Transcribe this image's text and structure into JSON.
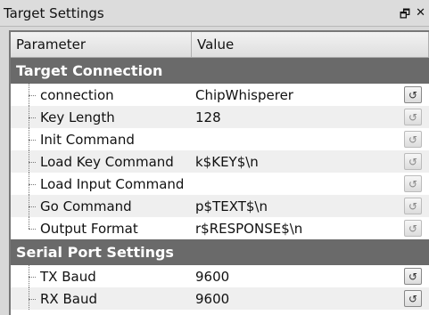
{
  "window": {
    "title": "Target Settings",
    "float_icon": "restore-icon",
    "close_icon": "close-icon"
  },
  "table": {
    "col_param": "Parameter",
    "col_value": "Value"
  },
  "groups": [
    {
      "label": "Target Connection",
      "rows": [
        {
          "name": "connection",
          "value": "ChipWhisperer",
          "reset_active": true
        },
        {
          "name": "Key Length",
          "value": "128",
          "reset_active": false
        },
        {
          "name": "Init Command",
          "value": "",
          "reset_active": false
        },
        {
          "name": "Load Key Command",
          "value": "k$KEY$\\n",
          "reset_active": false
        },
        {
          "name": "Load Input Command",
          "value": "",
          "reset_active": false
        },
        {
          "name": "Go Command",
          "value": "p$TEXT$\\n",
          "reset_active": false
        },
        {
          "name": "Output Format",
          "value": "r$RESPONSE$\\n",
          "reset_active": false
        }
      ]
    },
    {
      "label": "Serial Port Settings",
      "rows": [
        {
          "name": "TX Baud",
          "value": "9600",
          "reset_active": true
        },
        {
          "name": "RX Baud",
          "value": "9600",
          "reset_active": true
        }
      ]
    }
  ]
}
